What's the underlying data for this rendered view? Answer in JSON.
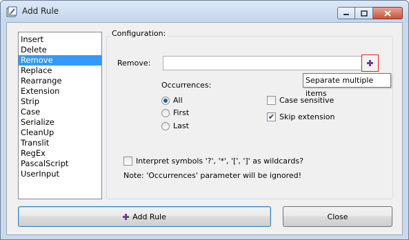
{
  "window": {
    "title": "Add Rule"
  },
  "rules": {
    "items": [
      "Insert",
      "Delete",
      "Remove",
      "Replace",
      "Rearrange",
      "Extension",
      "Strip",
      "Case",
      "Serialize",
      "CleanUp",
      "Translit",
      "RegEx",
      "PascalScript",
      "UserInput"
    ],
    "selected": "Remove"
  },
  "config": {
    "group_label": "Configuration:",
    "remove_label": "Remove:",
    "remove_value": "",
    "tooltip": "Separate multiple items",
    "occurrences_label": "Occurrences:",
    "occurrences": [
      {
        "label": "All",
        "checked": true
      },
      {
        "label": "First",
        "checked": false
      },
      {
        "label": "Last",
        "checked": false
      }
    ],
    "case_sensitive": {
      "label": "Case sensitive",
      "checked": false
    },
    "skip_extension": {
      "label": "Skip extension",
      "checked": true
    },
    "wildcards": {
      "label": "Interpret symbols '?', '*', '[', ']' as wildcards?",
      "checked": false
    },
    "note": "Note: 'Occurrences' parameter will be ignored!"
  },
  "buttons": {
    "add_rule": "Add Rule",
    "close": "Close"
  },
  "colors": {
    "selection": "#3399ff",
    "accent_plus": "#6f3e8c",
    "tooltip_target_border": "#e0221f"
  }
}
